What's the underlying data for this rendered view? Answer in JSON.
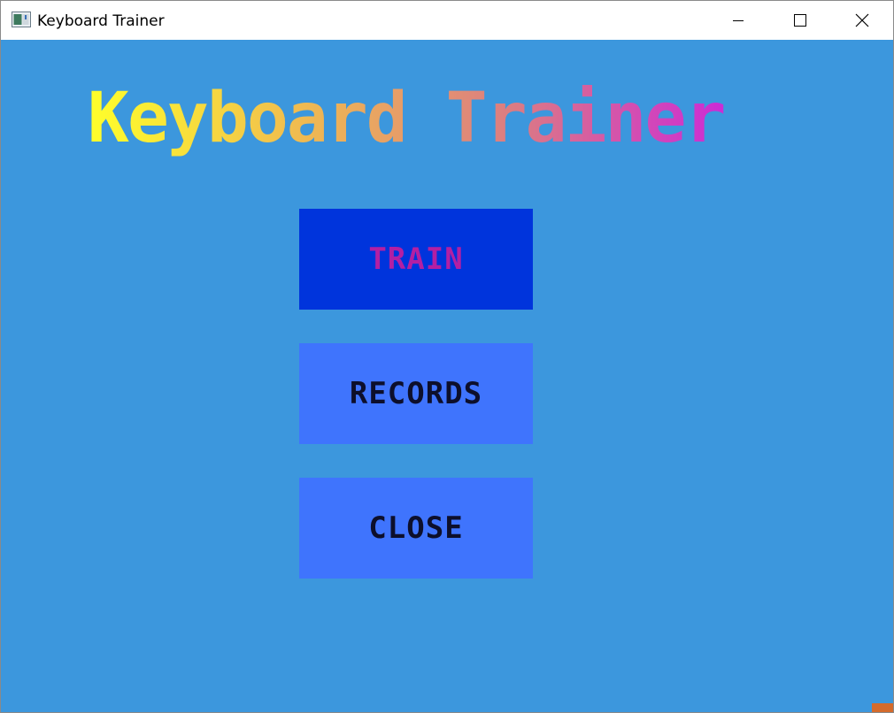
{
  "window": {
    "title": "Keyboard Trainer",
    "controls": {
      "minimize_icon": "minimize-icon",
      "maximize_icon": "maximize-icon",
      "close_icon": "close-icon"
    }
  },
  "game": {
    "title": "Keyboard Trainer",
    "background_color": "#3c97dd",
    "title_gradient": [
      "#ffff2a",
      "#f0bb50",
      "#dc7c82",
      "#cc2bd5"
    ]
  },
  "menu": {
    "items": [
      {
        "label": "TRAIN",
        "selected": true,
        "bg_color": "#0034dc",
        "text_color": "#b31fa3"
      },
      {
        "label": "RECORDS",
        "selected": false,
        "bg_color": "#3f74fd",
        "text_color": "#0d0f2b"
      },
      {
        "label": "CLOSE",
        "selected": false,
        "bg_color": "#3f74fd",
        "text_color": "#0d0f2b"
      }
    ]
  },
  "colors": {
    "corner_accent": "#d46b2c"
  }
}
